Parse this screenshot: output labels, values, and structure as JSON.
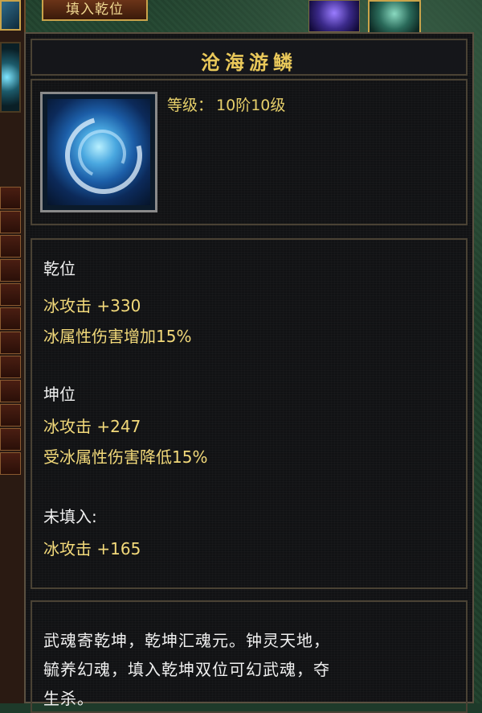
{
  "top_bar": {
    "fill_button_label": "填入乾位"
  },
  "tooltip": {
    "title": "沧海游鳞",
    "level": {
      "label": "等级：",
      "value": "10阶10级"
    },
    "sections": [
      {
        "heading": "乾位",
        "lines": [
          "冰攻击 +330",
          "冰属性伤害增加15%"
        ]
      },
      {
        "heading": "坤位",
        "lines": [
          "冰攻击 +247",
          "受冰属性伤害降低15%"
        ]
      },
      {
        "heading": "未填入:",
        "lines": [
          "冰攻击 +165"
        ]
      }
    ],
    "description_lines": [
      "武魂寄乾坤，乾坤汇魂元。钟灵天地，",
      "毓养幻魂，填入乾坤双位可幻武魂，夺",
      "生杀。"
    ]
  },
  "colors": {
    "title_gold": "#e9c85a",
    "text_gold": "#f2d97a",
    "text_white": "#f0f0f0",
    "tooltip_bg": "#111214",
    "border": "#4a4234"
  },
  "icons": {
    "item_icon": "ice-dragon-soul-icon",
    "top_icon_1": "purple-beast-icon",
    "top_icon_2": "green-beast-icon"
  }
}
